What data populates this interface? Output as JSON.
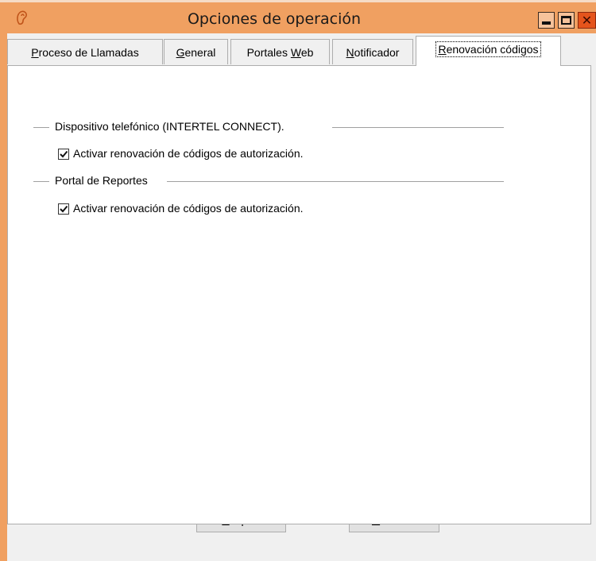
{
  "window": {
    "title": "Opciones de operación",
    "title_bar_color": "#f0a061",
    "close_color": "#e5541c"
  },
  "tabs": [
    {
      "pre": "",
      "key": "P",
      "post": "roceso de Llamadas",
      "active": false
    },
    {
      "pre": "",
      "key": "G",
      "post": "eneral",
      "active": false
    },
    {
      "pre": "Portales ",
      "key": "W",
      "post": "eb",
      "active": false
    },
    {
      "pre": "",
      "key": "N",
      "post": "otificador",
      "active": false
    },
    {
      "pre": "",
      "key": "R",
      "post": "enovación códigos",
      "active": true
    }
  ],
  "groups": [
    {
      "title": "Dispositivo telefónico (INTERTEL CONNECT).",
      "checkbox_label": "Activar renovación de códigos de autorización.",
      "checked": true
    },
    {
      "title": "Portal de Reportes",
      "checkbox_label": "Activar renovación de códigos de autorización.",
      "checked": true
    }
  ],
  "buttons": {
    "ok": {
      "key": "A",
      "rest": "ceptar"
    },
    "cancel": {
      "key": "C",
      "rest": "ancelar"
    }
  },
  "icons": {
    "app": "ear-icon",
    "minimize": "minimize-icon",
    "maximize": "maximize-icon",
    "close": "close-icon",
    "check": "checkmark-icon"
  }
}
